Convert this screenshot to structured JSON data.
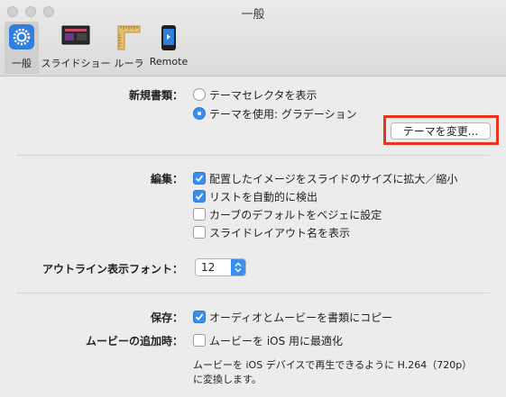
{
  "window": {
    "title": "一般"
  },
  "toolbar": {
    "items": [
      {
        "label": "一般",
        "icon": "gear-icon"
      },
      {
        "label": "スライドショー",
        "icon": "slideshow-icon"
      },
      {
        "label": "ルーラ",
        "icon": "ruler-icon"
      },
      {
        "label": "Remote",
        "icon": "remote-icon"
      }
    ]
  },
  "new_document": {
    "label": "新規書類：",
    "option1": "テーマセレクタを表示",
    "option2": "テーマを使用: グラデーション",
    "selected": 2,
    "change_theme_button": "テーマを変更..."
  },
  "editing": {
    "label": "編集：",
    "options": [
      {
        "text": "配置したイメージをスライドのサイズに拡大／縮小",
        "checked": true
      },
      {
        "text": "リストを自動的に検出",
        "checked": true
      },
      {
        "text": "カーブのデフォルトをベジェに設定",
        "checked": false
      },
      {
        "text": "スライドレイアウト名を表示",
        "checked": false
      }
    ]
  },
  "outline_font": {
    "label": "アウトライン表示フォント：",
    "value": "12"
  },
  "save": {
    "label": "保存：",
    "text": "オーディオとムービーを書類にコピー",
    "checked": true
  },
  "movie": {
    "label": "ムービーの追加時：",
    "text": "ムービーを iOS 用に最適化",
    "checked": false,
    "note": "ムービーを iOS デバイスで再生できるように H.264（720p）に変換します。"
  },
  "colors": {
    "accent": "#3b8df0",
    "highlight": "#e8331d"
  }
}
